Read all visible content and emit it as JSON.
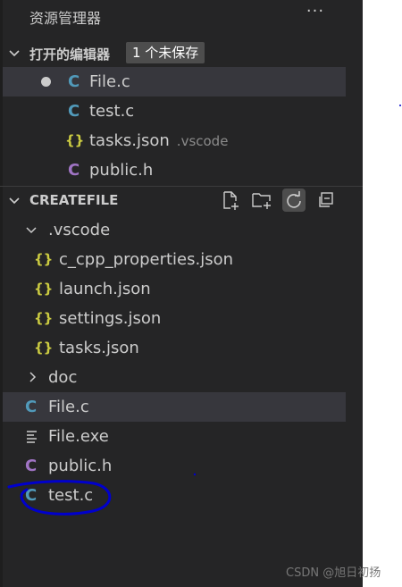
{
  "explorer": {
    "title": "资源管理器",
    "more_label": "···"
  },
  "open_editors": {
    "header": "打开的编辑器",
    "badge": "1 个未保存",
    "items": [
      {
        "icon": "C",
        "name": "File.c",
        "desc": "",
        "unsaved": true
      },
      {
        "icon": "C",
        "name": "test.c",
        "desc": ""
      },
      {
        "icon": "{}",
        "name": "tasks.json",
        "desc": ".vscode"
      },
      {
        "icon": "C",
        "name": "public.h",
        "desc": ""
      }
    ]
  },
  "folder": {
    "header": "CREATEFILE",
    "tree": [
      {
        "name": ".vscode",
        "type": "folder-open"
      },
      {
        "name": "c_cpp_properties.json",
        "type": "json"
      },
      {
        "name": "launch.json",
        "type": "json"
      },
      {
        "name": "settings.json",
        "type": "json"
      },
      {
        "name": "tasks.json",
        "type": "json"
      },
      {
        "name": "doc",
        "type": "folder-closed"
      },
      {
        "name": "File.c",
        "type": "c",
        "selected": true
      },
      {
        "name": "File.exe",
        "type": "exe"
      },
      {
        "name": "public.h",
        "type": "h"
      },
      {
        "name": "test.c",
        "type": "c"
      }
    ]
  },
  "watermark": "CSDN @旭日初扬",
  "colors": {
    "sidebar_bg": "#252526",
    "selected_row": "#37373d",
    "c_icon": "#519aba",
    "h_icon": "#a074c4",
    "json_icon": "#cbcb41",
    "annotation": "#0000cc"
  }
}
